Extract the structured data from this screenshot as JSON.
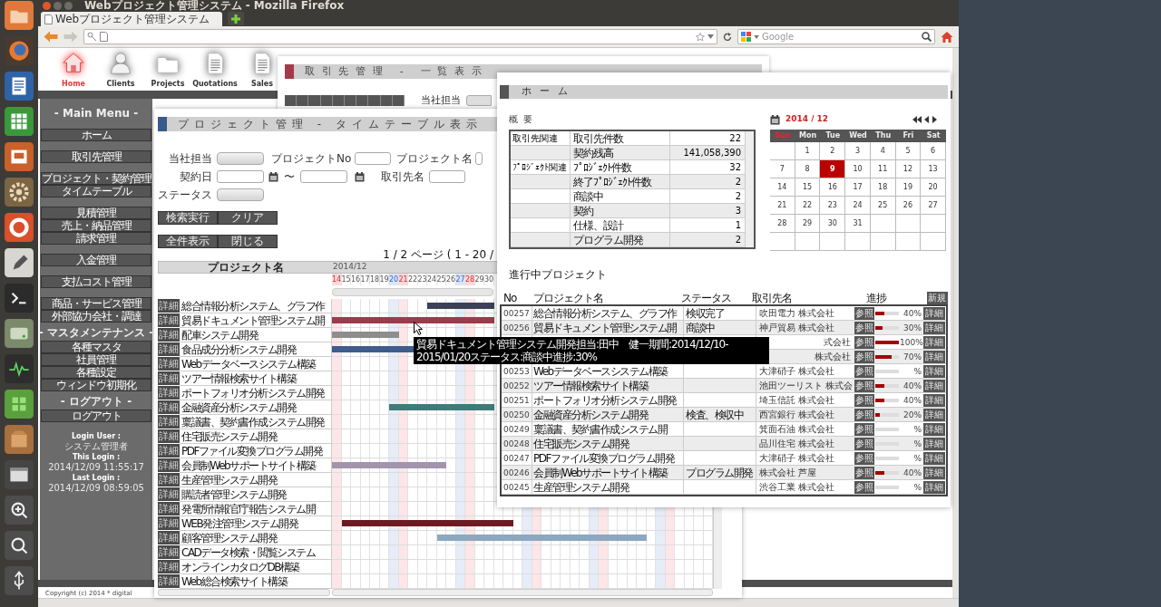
{
  "window_title": "Webプロジェクト管理システム - Mozilla Firefox",
  "browser": {
    "tab": "Webプロジェクト管理システム",
    "search_placeholder": "Google"
  },
  "app_nav": [
    {
      "label": "Home",
      "kind": "home",
      "selected": true
    },
    {
      "label": "Clients",
      "kind": "person",
      "selected": false
    },
    {
      "label": "Projects",
      "kind": "folder",
      "selected": false
    },
    {
      "label": "Quotations",
      "kind": "document",
      "selected": false
    },
    {
      "label": "Sales",
      "kind": "document",
      "selected": false
    }
  ],
  "main_menu": {
    "sections": [
      {
        "heading": "- Main Menu -",
        "groups": [
          [
            "ホーム"
          ],
          [
            "取引先管理"
          ],
          [
            "プロジェクト・契約管理",
            "タイムテーブル"
          ],
          [
            "見積管理",
            "売上・納品管理",
            "請求管理"
          ],
          [
            "入金管理"
          ],
          [
            "支払コスト管理"
          ],
          [
            "商品・サービス管理",
            "外部協力会社・調達"
          ]
        ]
      },
      {
        "heading": "- マスタメンテナンス -",
        "groups": [
          [
            "各種マスタ",
            "社員管理",
            "各種設定",
            "ウィンドウ初期化"
          ]
        ]
      },
      {
        "heading": "- ログアウト -",
        "groups": [
          [
            "ログアウト"
          ]
        ]
      }
    ],
    "login": [
      {
        "label": "Login User :",
        "value": "システム管理者"
      },
      {
        "label": "This Login :",
        "value": "2014/12/09 11:55:17"
      },
      {
        "label": "Last Login :",
        "value": "2014/12/09 08:59:05"
      }
    ]
  },
  "copyright": "Copyright (c) 2014 * digital",
  "client_window": {
    "title": "取引先管理 - 一覧表示",
    "staff_label": "当社担当"
  },
  "timeline_window": {
    "title": "プロジェクト管理 - タイムテーブル表示",
    "form": {
      "staff_label": "当社担当",
      "project_no_label": "プロジェクトNo",
      "project_name_label": "プロジェクト名",
      "contract_date_label": "契約日",
      "range_separator": "〜",
      "client_label": "取引先名",
      "status_label": "ステータス"
    },
    "search_buttons": [
      "検索実行",
      "クリア"
    ],
    "list_buttons": [
      "全件表示",
      "閉じる"
    ],
    "paging": "1 / 2 ページ ( 1 - 20 /",
    "name_header": "プロジェクト名",
    "month": "2014/12",
    "days": [
      {
        "label": "14",
        "kind": "sun"
      },
      {
        "label": "15",
        "kind": "weekday"
      },
      {
        "label": "16",
        "kind": "weekday"
      },
      {
        "label": "17",
        "kind": "weekday"
      },
      {
        "label": "18",
        "kind": "weekday"
      },
      {
        "label": "19",
        "kind": "weekday"
      },
      {
        "label": "20",
        "kind": "sat"
      },
      {
        "label": "21",
        "kind": "sun"
      },
      {
        "label": "22",
        "kind": "weekday"
      },
      {
        "label": "23",
        "kind": "weekday"
      },
      {
        "label": "24",
        "kind": "weekday"
      },
      {
        "label": "25",
        "kind": "weekday"
      },
      {
        "label": "26",
        "kind": "weekday"
      },
      {
        "label": "27",
        "kind": "sat"
      },
      {
        "label": "28",
        "kind": "sun"
      },
      {
        "label": "29",
        "kind": "weekday"
      },
      {
        "label": "30",
        "kind": "weekday"
      },
      {
        "kind": "weekday"
      },
      {
        "kind": "weekday"
      },
      {
        "kind": "weekday"
      },
      {
        "kind": "sat"
      },
      {
        "kind": "sun"
      },
      {
        "kind": "weekday"
      },
      {
        "kind": "weekday"
      },
      {
        "kind": "weekday"
      },
      {
        "kind": "weekday"
      },
      {
        "kind": "weekday"
      },
      {
        "kind": "sat"
      },
      {
        "kind": "sun"
      },
      {
        "kind": "weekday"
      },
      {
        "kind": "weekday"
      },
      {
        "kind": "weekday"
      },
      {
        "kind": "weekday"
      },
      {
        "kind": "weekday"
      },
      {
        "kind": "sat"
      },
      {
        "kind": "sun"
      },
      {
        "kind": "weekday"
      },
      {
        "kind": "weekday"
      },
      {
        "kind": "weekday"
      },
      {
        "kind": "weekday"
      }
    ],
    "rows": [
      {
        "button": "詳細",
        "name": "総合情報分析システム、グラフ作",
        "bar": {
          "color": "#3b4258"
        }
      },
      {
        "button": "詳細",
        "name": "貿易ドキュメント管理システム開",
        "bar": {
          "color": "#9b3b4b"
        }
      },
      {
        "button": "詳細",
        "name": "配車システム開発",
        "bar": {
          "color": "#8e8e8e"
        }
      },
      {
        "button": "詳細",
        "name": "食品成分分析システム開発",
        "bar": {
          "color": "#3e5c8c"
        }
      },
      {
        "button": "詳細",
        "name": "Webデータベースシステム構築"
      },
      {
        "button": "詳細",
        "name": "ツアー情報検索サイト構築"
      },
      {
        "button": "詳細",
        "name": "ポートフォリオ分析システム開発"
      },
      {
        "button": "詳細",
        "name": "金融資産分析システム開発",
        "bar": {
          "color": "#3f7b78"
        }
      },
      {
        "button": "詳細",
        "name": "稟議書、契約書作成システム開発"
      },
      {
        "button": "詳細",
        "name": "住宅販売システム開発"
      },
      {
        "button": "詳細",
        "name": "PDFファイル変換プログラム開発"
      },
      {
        "button": "詳細",
        "name": "会員制Webサポートサイト構築",
        "bar": {
          "color": "#a394ad"
        }
      },
      {
        "button": "詳細",
        "name": "生産管理システム開発"
      },
      {
        "button": "詳細",
        "name": "購読者管理システム開発"
      },
      {
        "button": "詳細",
        "name": "発電所情報官庁報告システム開"
      },
      {
        "button": "詳細",
        "name": "WEB発注管理システム開発",
        "bar": {
          "color": "#6b1a22"
        }
      },
      {
        "button": "詳細",
        "name": "顧客管理システム開発",
        "bar": {
          "color": "#8ca7c0"
        }
      },
      {
        "button": "詳細",
        "name": "CADデータ検索・閲覧システム"
      },
      {
        "button": "詳細",
        "name": "オンラインカタログDB構築"
      },
      {
        "button": "詳細",
        "name": "Web総合検索サイト構築"
      }
    ]
  },
  "home_window": {
    "title": "ホーム",
    "overview_heading": "概要",
    "overview": [
      {
        "group": "取引先関連",
        "item": "取引先件数",
        "value": "22"
      },
      {
        "item": "契約残高",
        "value": "141,058,390"
      },
      {
        "group": "ﾌﾟﾛｼﾞｪｸﾄ関連",
        "item": "ﾌﾟﾛｼﾞｪｸﾄ件数",
        "value": "32"
      },
      {
        "item": "終了ﾌﾟﾛｼﾞｪｸﾄ件数",
        "value": "2"
      },
      {
        "item": "商談中",
        "value": "2"
      },
      {
        "item": "契約",
        "value": "3"
      },
      {
        "item": "仕様、設計",
        "value": "1"
      },
      {
        "item": "プログラム開発",
        "value": "2"
      }
    ],
    "calendar": {
      "month": "2014 / 12",
      "weekdays": [
        {
          "label": "Sun",
          "kind": "sun"
        },
        {
          "label": "Mon",
          "kind": "weekday"
        },
        {
          "label": "Tue",
          "kind": "weekday"
        },
        {
          "label": "Wed",
          "kind": "weekday"
        },
        {
          "label": "Thu",
          "kind": "weekday"
        },
        {
          "label": "Fri",
          "kind": "weekday"
        },
        {
          "label": "Sat",
          "kind": "weekday"
        }
      ],
      "weeks": [
        [
          {
            "selected": false
          },
          {
            "label": "1",
            "selected": false
          },
          {
            "label": "2",
            "selected": false
          },
          {
            "label": "3",
            "selected": false
          },
          {
            "label": "4",
            "selected": false
          },
          {
            "label": "5",
            "selected": false
          },
          {
            "label": "6",
            "selected": false
          }
        ],
        [
          {
            "label": "7",
            "selected": false
          },
          {
            "label": "8",
            "selected": false
          },
          {
            "label": "9",
            "selected": true
          },
          {
            "label": "10",
            "selected": false
          },
          {
            "label": "11",
            "selected": false
          },
          {
            "label": "12",
            "selected": false
          },
          {
            "label": "13",
            "selected": false
          }
        ],
        [
          {
            "label": "14",
            "selected": false
          },
          {
            "label": "15",
            "selected": false
          },
          {
            "label": "16",
            "selected": false
          },
          {
            "label": "17",
            "selected": false
          },
          {
            "label": "18",
            "selected": false
          },
          {
            "label": "19",
            "selected": false
          },
          {
            "label": "20",
            "selected": false
          }
        ],
        [
          {
            "label": "21",
            "selected": false
          },
          {
            "label": "22",
            "selected": false
          },
          {
            "label": "23",
            "selected": false
          },
          {
            "label": "24",
            "selected": false
          },
          {
            "label": "25",
            "selected": false
          },
          {
            "label": "26",
            "selected": false
          },
          {
            "label": "27",
            "selected": false
          }
        ],
        [
          {
            "label": "28",
            "selected": false
          },
          {
            "label": "29",
            "selected": false
          },
          {
            "label": "30",
            "selected": false
          },
          {
            "label": "31",
            "selected": false
          },
          {
            "selected": false
          },
          {
            "selected": false
          },
          {
            "selected": false
          }
        ],
        [
          {
            "selected": false
          },
          {
            "selected": false
          },
          {
            "selected": false
          },
          {
            "selected": false
          },
          {
            "selected": false
          },
          {
            "selected": false
          },
          {
            "selected": false
          }
        ]
      ]
    },
    "projects_heading": "進行中プロジェクト",
    "columns": [
      "No",
      "プロジェクト名",
      "ステータス",
      "取引先名",
      "進捗"
    ],
    "new_button": "新規",
    "projects": [
      {
        "no": "00257",
        "name": "総合情報分析システム、グラフ作",
        "status": "検収完了",
        "client": "吹田電力 株式会社",
        "ref": "参照",
        "level": 0.4,
        "percent": "40%",
        "detail": "詳細"
      },
      {
        "no": "00256",
        "name": "貿易ドキュメント管理システム開",
        "status": "商談中",
        "client": "神戸貿易 株式会社",
        "ref": "参照",
        "level": 0.3,
        "percent": "30%",
        "detail": "詳細"
      },
      {
        "client": "式会社",
        "ref": "参照",
        "level": 1,
        "percent": "100%",
        "detail": "詳細"
      },
      {
        "client": "株式会社",
        "ref": "参照",
        "level": 0.7,
        "percent": "70%",
        "detail": "詳細"
      },
      {
        "no": "00253",
        "name": "Webデータベースシステム構築",
        "client": "大津硝子 株式会社",
        "ref": "参照",
        "level": 0,
        "percent": "%",
        "detail": "詳細"
      },
      {
        "no": "00252",
        "name": "ツアー情報検索サイト構築",
        "client": "池田ツーリスト 株式会",
        "ref": "参照",
        "level": 0.4,
        "percent": "40%",
        "detail": "詳細"
      },
      {
        "no": "00251",
        "name": "ポートフォリオ分析システム開発",
        "client": "埼玉信託 株式会社",
        "ref": "参照",
        "level": 0.4,
        "percent": "40%",
        "detail": "詳細"
      },
      {
        "no": "00250",
        "name": "金融資産分析システム開発",
        "status": "検査、検収中",
        "client": "西宮銀行 株式会社",
        "ref": "参照",
        "level": 0.2,
        "percent": "20%",
        "detail": "詳細"
      },
      {
        "no": "00249",
        "name": "稟議書、契約書作成システム開",
        "client": "箕面石油 株式会社",
        "ref": "参照",
        "level": 0,
        "percent": "%",
        "detail": "詳細"
      },
      {
        "no": "00248",
        "name": "住宅販売システム開発",
        "client": "品川住宅 株式会社",
        "ref": "参照",
        "level": 0,
        "percent": "%",
        "detail": "詳細"
      },
      {
        "no": "00247",
        "name": "PDFファイル変換プログラム開発",
        "client": "大津硝子 株式会社",
        "ref": "参照",
        "level": 0,
        "percent": "%",
        "detail": "詳細"
      },
      {
        "no": "00246",
        "name": "会員制Webサポートサイト構築",
        "status": "プログラム開発",
        "client": "株式会社 芦屋",
        "ref": "参照",
        "level": 0.4,
        "percent": "40%",
        "detail": "詳細"
      },
      {
        "no": "00245",
        "name": "生産管理システム開発",
        "client": "渋谷工業 株式会社",
        "ref": "参照",
        "level": 0,
        "percent": "%",
        "detail": "詳細"
      }
    ]
  },
  "tooltip": "貿易ドキュメント管理システム開発担当:田中　健一期間:2014/12/10-2015/01/20ステータス:商談中進捗:30%"
}
